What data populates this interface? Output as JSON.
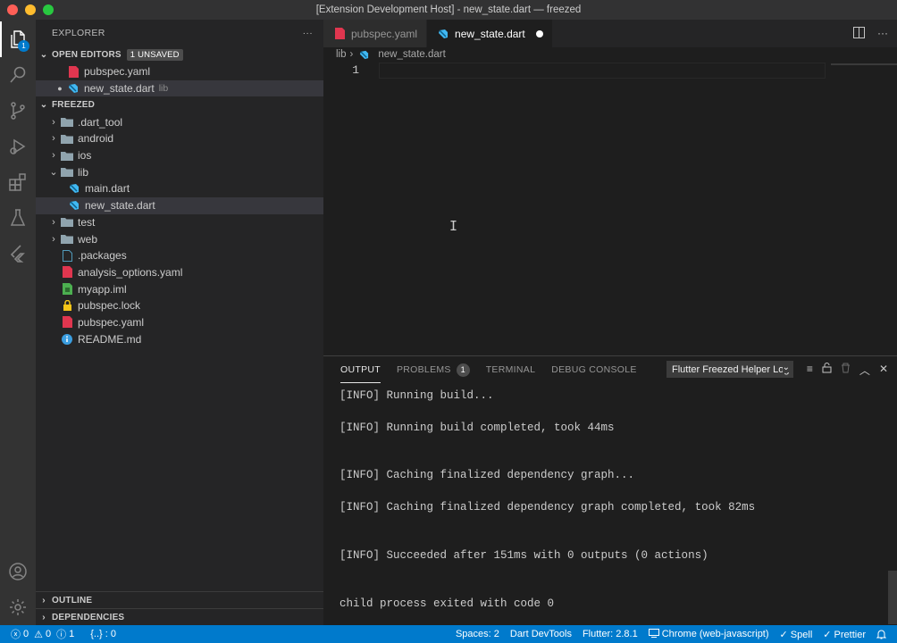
{
  "window": {
    "title": "[Extension Development Host] - new_state.dart — freezed"
  },
  "activity_bar": {
    "explorer_badge": "1",
    "items": [
      "explorer",
      "search",
      "source-control",
      "run-debug",
      "extensions",
      "testing",
      "flutter",
      "accounts",
      "manage"
    ]
  },
  "sidebar": {
    "header": "EXPLORER",
    "more": "···",
    "open_editors": {
      "title": "OPEN EDITORS",
      "badge": "1 UNSAVED",
      "items": [
        {
          "name": "pubspec.yaml",
          "desc": "",
          "icon": "yaml-icon",
          "dirty": false
        },
        {
          "name": "new_state.dart",
          "desc": "lib",
          "icon": "dart-icon",
          "dirty": true
        }
      ]
    },
    "project": {
      "title": "FREEZED",
      "items": [
        {
          "name": ".dart_tool",
          "type": "folder",
          "expanded": false,
          "depth": 0
        },
        {
          "name": "android",
          "type": "folder",
          "expanded": false,
          "depth": 0
        },
        {
          "name": "ios",
          "type": "folder",
          "expanded": false,
          "depth": 0
        },
        {
          "name": "lib",
          "type": "folder",
          "expanded": true,
          "depth": 0
        },
        {
          "name": "main.dart",
          "type": "dart",
          "depth": 1
        },
        {
          "name": "new_state.dart",
          "type": "dart",
          "depth": 1,
          "selected": true
        },
        {
          "name": "test",
          "type": "folder",
          "expanded": false,
          "depth": 0
        },
        {
          "name": "web",
          "type": "folder",
          "expanded": false,
          "depth": 0
        },
        {
          "name": ".packages",
          "type": "file",
          "depth": 0
        },
        {
          "name": "analysis_options.yaml",
          "type": "yaml",
          "depth": 0
        },
        {
          "name": "myapp.iml",
          "type": "iml",
          "depth": 0
        },
        {
          "name": "pubspec.lock",
          "type": "lock",
          "depth": 0
        },
        {
          "name": "pubspec.yaml",
          "type": "yaml",
          "depth": 0
        },
        {
          "name": "README.md",
          "type": "info",
          "depth": 0
        }
      ]
    },
    "outline": "OUTLINE",
    "dependencies": "DEPENDENCIES"
  },
  "editor": {
    "tabs": [
      {
        "label": "pubspec.yaml",
        "active": false
      },
      {
        "label": "new_state.dart",
        "active": true,
        "modified": true
      }
    ],
    "breadcrumb": {
      "folder": "lib",
      "separator": "›",
      "file": "new_state.dart"
    },
    "line_number": "1",
    "cursor_glyph": "I"
  },
  "panel": {
    "tabs": [
      {
        "label": "OUTPUT",
        "active": true
      },
      {
        "label": "PROBLEMS",
        "badge": "1"
      },
      {
        "label": "TERMINAL"
      },
      {
        "label": "DEBUG CONSOLE"
      }
    ],
    "channel": "Flutter Freezed Helper Log",
    "output_lines": [
      "[INFO] Running build...",
      "",
      "[INFO] Running build completed, took 44ms",
      "",
      "",
      "[INFO] Caching finalized dependency graph...",
      "",
      "[INFO] Caching finalized dependency graph completed, took 82ms",
      "",
      "",
      "[INFO] Succeeded after 151ms with 0 outputs (0 actions)",
      "",
      "",
      "child process exited with code 0"
    ]
  },
  "statusbar": {
    "errors": "0",
    "warnings": "0",
    "info": "1",
    "braces": "{..} : 0",
    "spaces": "Spaces: 2",
    "devtools": "Dart DevTools",
    "flutter": "Flutter: 2.8.1",
    "device": "Chrome (web-javascript)",
    "spell": "✓ Spell",
    "prettier": "✓ Prettier"
  },
  "colors": {
    "accent": "#007acc",
    "dart": "#40b8f2",
    "yaml": "#e0364f",
    "folder": "#90a4ae",
    "lock": "#f5c518",
    "info": "#3b9ee0"
  }
}
